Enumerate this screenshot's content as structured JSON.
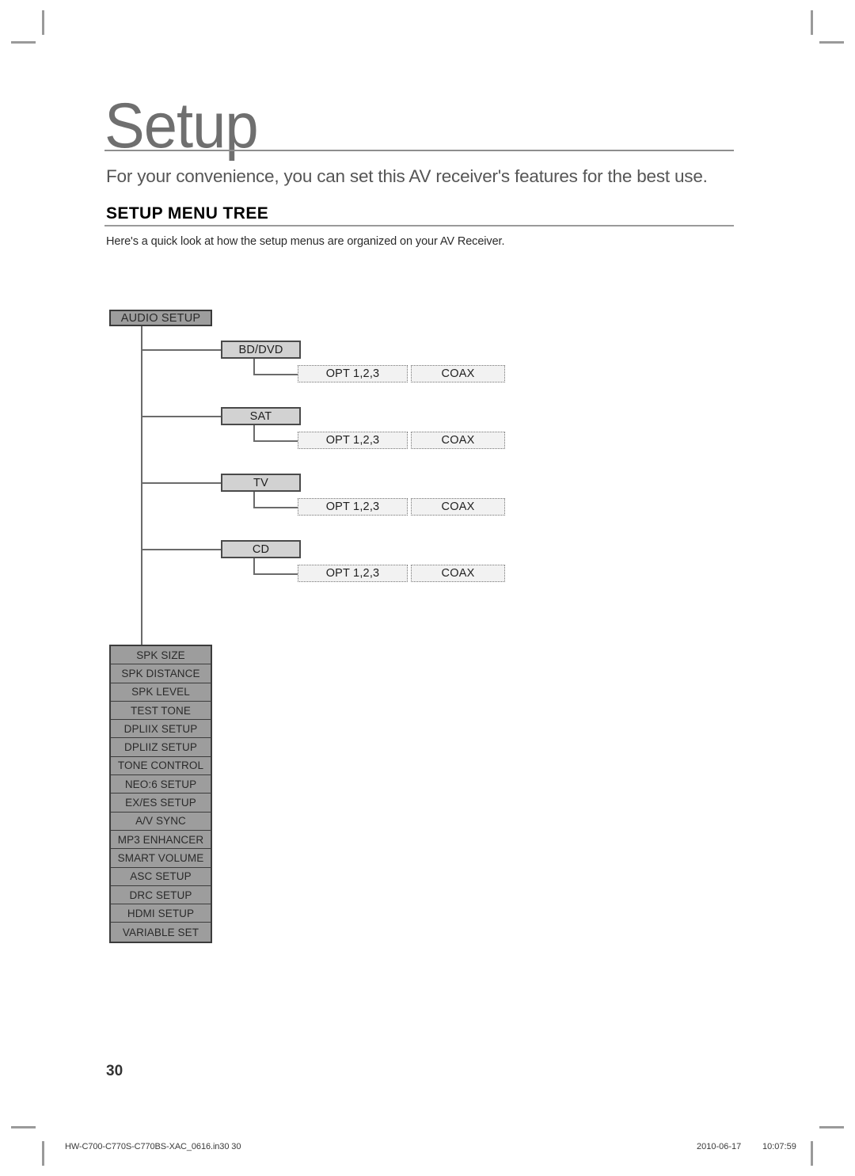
{
  "page": {
    "title": "Setup",
    "subtitle": "For your convenience, you can set this AV receiver's features for the best use.",
    "section_heading": "SETUP MENU TREE",
    "section_body": "Here's a quick look at how the setup menus are organized on your AV Receiver.",
    "page_number": "30"
  },
  "footer": {
    "filename": "HW-C700-C770S-C770BS-XAC_0616.in30   30",
    "date": "2010-06-17",
    "time": "10:07:59"
  },
  "tree": {
    "root": {
      "label": "AUDIO SETUP"
    },
    "branches": [
      {
        "label": "BD/DVD",
        "leaves": [
          "OPT 1,2,3",
          "COAX"
        ]
      },
      {
        "label": "SAT",
        "leaves": [
          "OPT 1,2,3",
          "COAX"
        ]
      },
      {
        "label": "TV",
        "leaves": [
          "OPT 1,2,3",
          "COAX"
        ]
      },
      {
        "label": "CD",
        "leaves": [
          "OPT 1,2,3",
          "COAX"
        ]
      }
    ],
    "menu_items": [
      "SPK SIZE",
      "SPK DISTANCE",
      "SPK LEVEL",
      "TEST TONE",
      "DPLIIX SETUP",
      "DPLIIZ SETUP",
      "TONE CONTROL",
      "NEO:6 SETUP",
      "EX/ES SETUP",
      "A/V SYNC",
      "MP3 ENHANCER",
      "SMART VOLUME",
      "ASC SETUP",
      "DRC SETUP",
      "HDMI SETUP",
      "VARIABLE SET"
    ]
  },
  "colors": {
    "root_fill": "#9d9d9d",
    "branch_fill": "#d2d2d2",
    "leaf_fill": "#f2f2f2",
    "line": "#6b6b6b",
    "rule": "#9a9a9a"
  }
}
